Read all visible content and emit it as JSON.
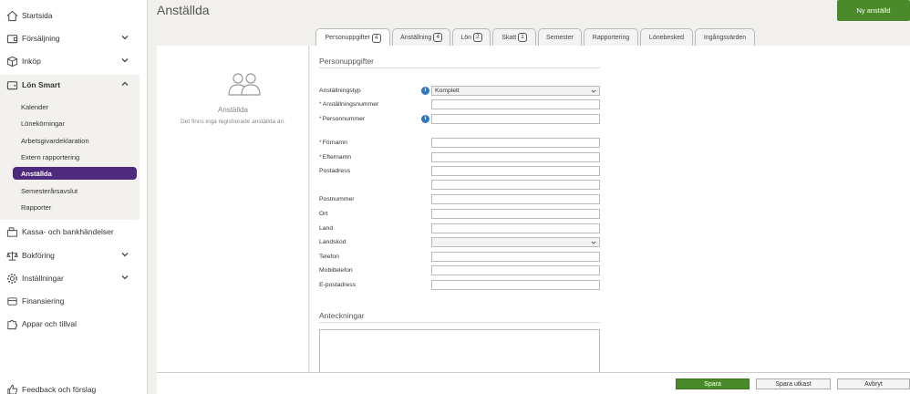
{
  "sidebar": {
    "items": [
      {
        "label": "Startsida"
      },
      {
        "label": "Försäljning"
      },
      {
        "label": "Inköp"
      },
      {
        "label": "Lön Smart"
      },
      {
        "label": "Kassa- och bankhändelser"
      },
      {
        "label": "Bokföring"
      },
      {
        "label": "Inställningar"
      },
      {
        "label": "Finansiering"
      },
      {
        "label": "Appar och tillval"
      },
      {
        "label": "Feedback och förslag"
      }
    ],
    "sub_items": [
      {
        "label": "Kalender"
      },
      {
        "label": "Lönekörningar"
      },
      {
        "label": "Arbetsgivardeklaration"
      },
      {
        "label": "Extern rapportering"
      },
      {
        "label": "Anställda"
      },
      {
        "label": "Semesterårsavslut"
      },
      {
        "label": "Rapporter"
      }
    ]
  },
  "header": {
    "title": "Anställda",
    "new_button": "Ny anställd"
  },
  "tabs": [
    {
      "label": "Personuppgifter",
      "badge": "4"
    },
    {
      "label": "Anställning",
      "badge": "4"
    },
    {
      "label": "Lön",
      "badge": "2"
    },
    {
      "label": "Skatt",
      "badge": "1"
    },
    {
      "label": "Semester",
      "badge": ""
    },
    {
      "label": "Rapportering",
      "badge": ""
    },
    {
      "label": "Lönebesked",
      "badge": ""
    },
    {
      "label": "Ingångsvärden",
      "badge": ""
    }
  ],
  "left_panel": {
    "empty_title": "Anställda",
    "empty_text": "Det finns inga registrerade anställda än."
  },
  "form": {
    "section_title": "Personuppgifter",
    "fields": [
      {
        "label": "Anställningstyp",
        "value": "Komplett",
        "required": false
      },
      {
        "label": "Anställningsnummer",
        "value": "",
        "required": true
      },
      {
        "label": "Personnummer",
        "value": "",
        "required": true
      },
      {
        "label": "Förnamn",
        "value": "",
        "required": true
      },
      {
        "label": "Efternamn",
        "value": "",
        "required": true
      },
      {
        "label": "Postadress",
        "value": "",
        "required": false
      },
      {
        "label": "Postnummer",
        "value": "",
        "required": false
      },
      {
        "label": "Ort",
        "value": "",
        "required": false
      },
      {
        "label": "Land",
        "value": "",
        "required": false
      },
      {
        "label": "Landskod",
        "value": "",
        "required": false
      },
      {
        "label": "Telefon",
        "value": "",
        "required": false
      },
      {
        "label": "Mobiltelefon",
        "value": "",
        "required": false
      },
      {
        "label": "E-postadress",
        "value": "",
        "required": false
      }
    ],
    "required_marker": "*",
    "info_glyph": "i",
    "notes_title": "Anteckningar"
  },
  "footer": {
    "save": "Spara",
    "save_draft": "Spara utkast",
    "cancel": "Avbryt"
  },
  "colors": {
    "accent_purple": "#4e2a7f",
    "primary_green": "#4a8a2a",
    "info_blue": "#2a77c8"
  }
}
